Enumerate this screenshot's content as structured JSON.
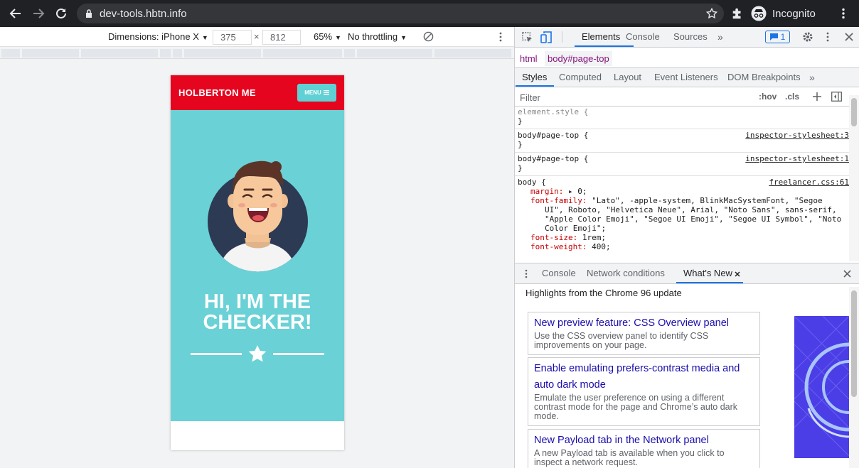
{
  "browser": {
    "url": "dev-tools.hbtn.info",
    "profile_label": "Incognito"
  },
  "device_toolbar": {
    "dimensions_label": "Dimensions: iPhone X",
    "width": "375",
    "times": "×",
    "height": "812",
    "zoom": "65%",
    "throttling": "No throttling"
  },
  "page": {
    "brand": "HOLBERTON ME",
    "menu_label": "MENU",
    "headline_line1": "HI, I'M THE",
    "headline_line2": "CHECKER!",
    "colors": {
      "nav": "#e5051f",
      "hero": "#6ad1d6",
      "menu_btn": "#5fd0d4"
    }
  },
  "devtools": {
    "tabs": [
      "Elements",
      "Console",
      "Sources"
    ],
    "issues_count": "1",
    "breadcrumb": [
      "html",
      "body#page-top"
    ],
    "styles_tabs": [
      "Styles",
      "Computed",
      "Layout",
      "Event Listeners",
      "DOM Breakpoints"
    ],
    "filter_placeholder": "Filter",
    "hov": ":hov",
    "cls": ".cls",
    "rules": {
      "element_style": "element.style {",
      "close": "}",
      "r1_selector": "body#page-top {",
      "r1_source": "inspector-stylesheet:3",
      "r2_selector": "body#page-top {",
      "r2_source": "inspector-stylesheet:1",
      "r3_selector": "body {",
      "r3_source": "freelancer.css:61",
      "margin_name": "margin",
      "margin_value": "0;",
      "ff_name": "font-family",
      "ff_value_1": "\"Lato\", -apple-system, BlinkMacSystemFont, \"Segoe",
      "ff_value_2": "UI\", Roboto, \"Helvetica Neue\", Arial, \"Noto Sans\", sans-serif,",
      "ff_value_3": "\"Apple Color Emoji\", \"Segoe UI Emoji\", \"Segoe UI Symbol\", \"Noto",
      "ff_value_4": "Color Emoji\";",
      "fs_name": "font-size",
      "fs_value": "1rem;",
      "fw_name": "font-weight",
      "fw_value": "400;"
    },
    "drawer": {
      "tabs": [
        "Console",
        "Network conditions",
        "What's New"
      ],
      "heading": "Highlights from the Chrome 96 update",
      "cards": [
        {
          "title": "New preview feature: CSS Overview panel",
          "desc_1": "Use the CSS overview panel to identify CSS",
          "desc_2": "improvements on your page."
        },
        {
          "title_1": "Enable emulating prefers-contrast media and",
          "title_2": "auto dark mode",
          "desc_1": "Emulate the user preference on using a different",
          "desc_2": "contrast mode for the page and Chrome’s auto dark",
          "desc_3": "mode."
        },
        {
          "title": "New Payload tab in the Network panel",
          "desc_1": "A new Payload tab is available when you click to",
          "desc_2": "inspect a network request."
        }
      ]
    }
  }
}
